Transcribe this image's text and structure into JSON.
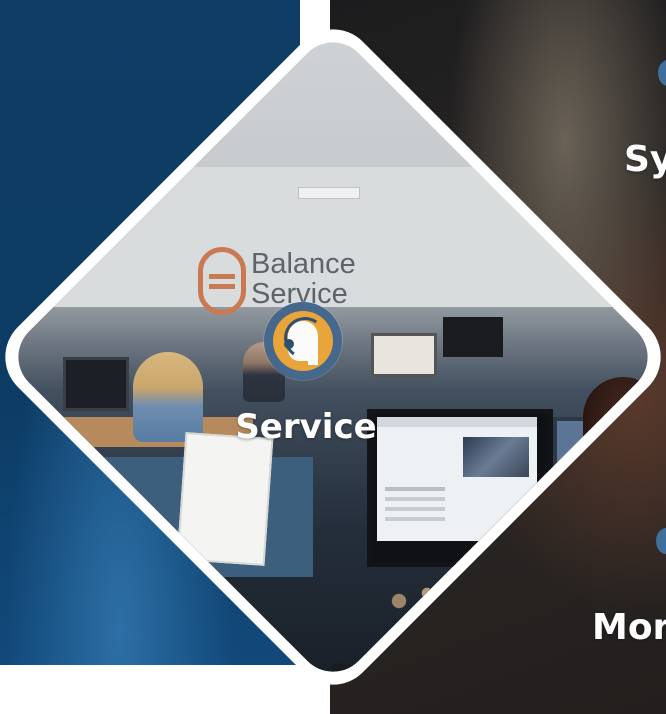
{
  "photo_logo": {
    "line1": "Balance",
    "line2": "Service"
  },
  "tiles": {
    "center_label": "Service",
    "right_top_label": "Sy",
    "right_bottom_label": "Mor"
  },
  "icons": {
    "center": "headset-support-icon"
  },
  "colors": {
    "background_blue": "#0c3b63",
    "badge_ring": "#45688c",
    "badge_fill": "#e9a43a",
    "logo_orange": "#c97a52"
  }
}
